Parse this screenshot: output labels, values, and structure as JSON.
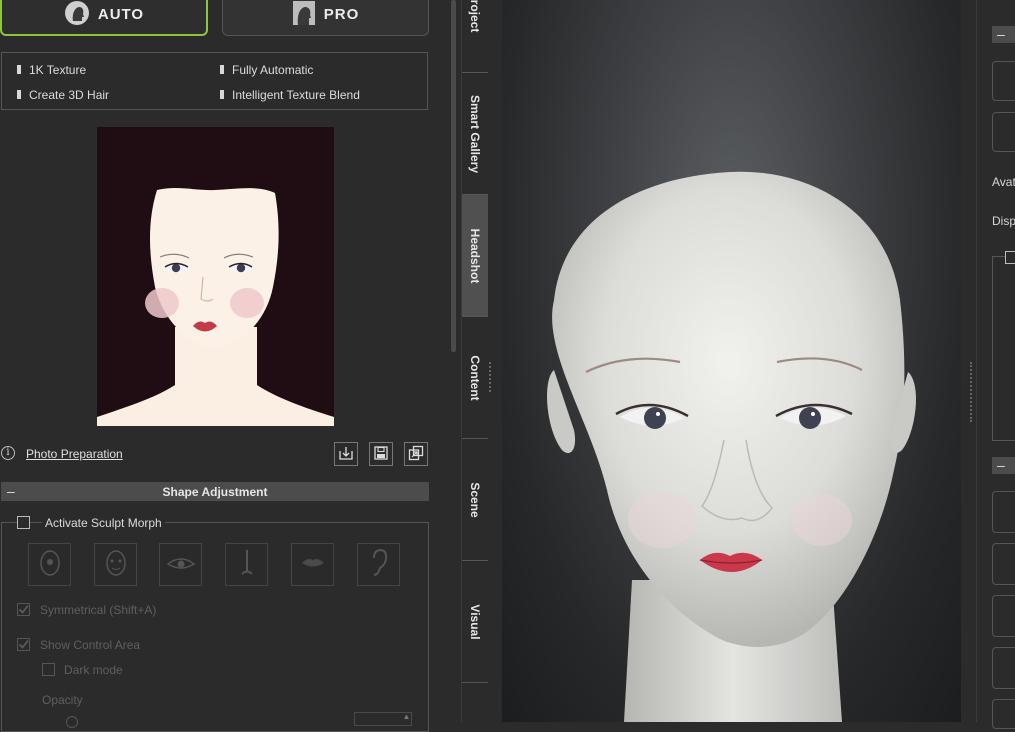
{
  "mode_buttons": {
    "auto": "AUTO",
    "pro": "PRO"
  },
  "features": [
    "1K Texture",
    "Fully Automatic",
    "Create 3D Hair",
    "Intelligent Texture Blend"
  ],
  "photo_preparation": "Photo Preparation",
  "shape_adjustment": {
    "title": "Shape Adjustment",
    "activate_sculpt_morph": "Activate Sculpt Morph",
    "symmetrical": "Symmetrical (Shift+A)",
    "show_control_area": "Show Control Area",
    "dark_mode": "Dark mode",
    "opacity": "Opacity"
  },
  "side_tabs": [
    "Project",
    "Smart Gallery",
    "Headshot",
    "Content",
    "Scene",
    "Visual"
  ],
  "active_tab": "Headshot",
  "right_panel": {
    "avatar_label": "Avat",
    "display_label": "Disp"
  },
  "colors": {
    "accent": "#8cc63f",
    "panel": "#2b2b2b",
    "header_bar": "#4c4c4c"
  },
  "icons": [
    "auto-head-icon",
    "pro-head-icon",
    "info-icon",
    "load-image-icon",
    "save-icon",
    "export-icon",
    "sculpt-head-icon",
    "sculpt-face-icon",
    "sculpt-eye-icon",
    "sculpt-nose-icon",
    "sculpt-mouth-icon",
    "sculpt-ear-icon"
  ]
}
